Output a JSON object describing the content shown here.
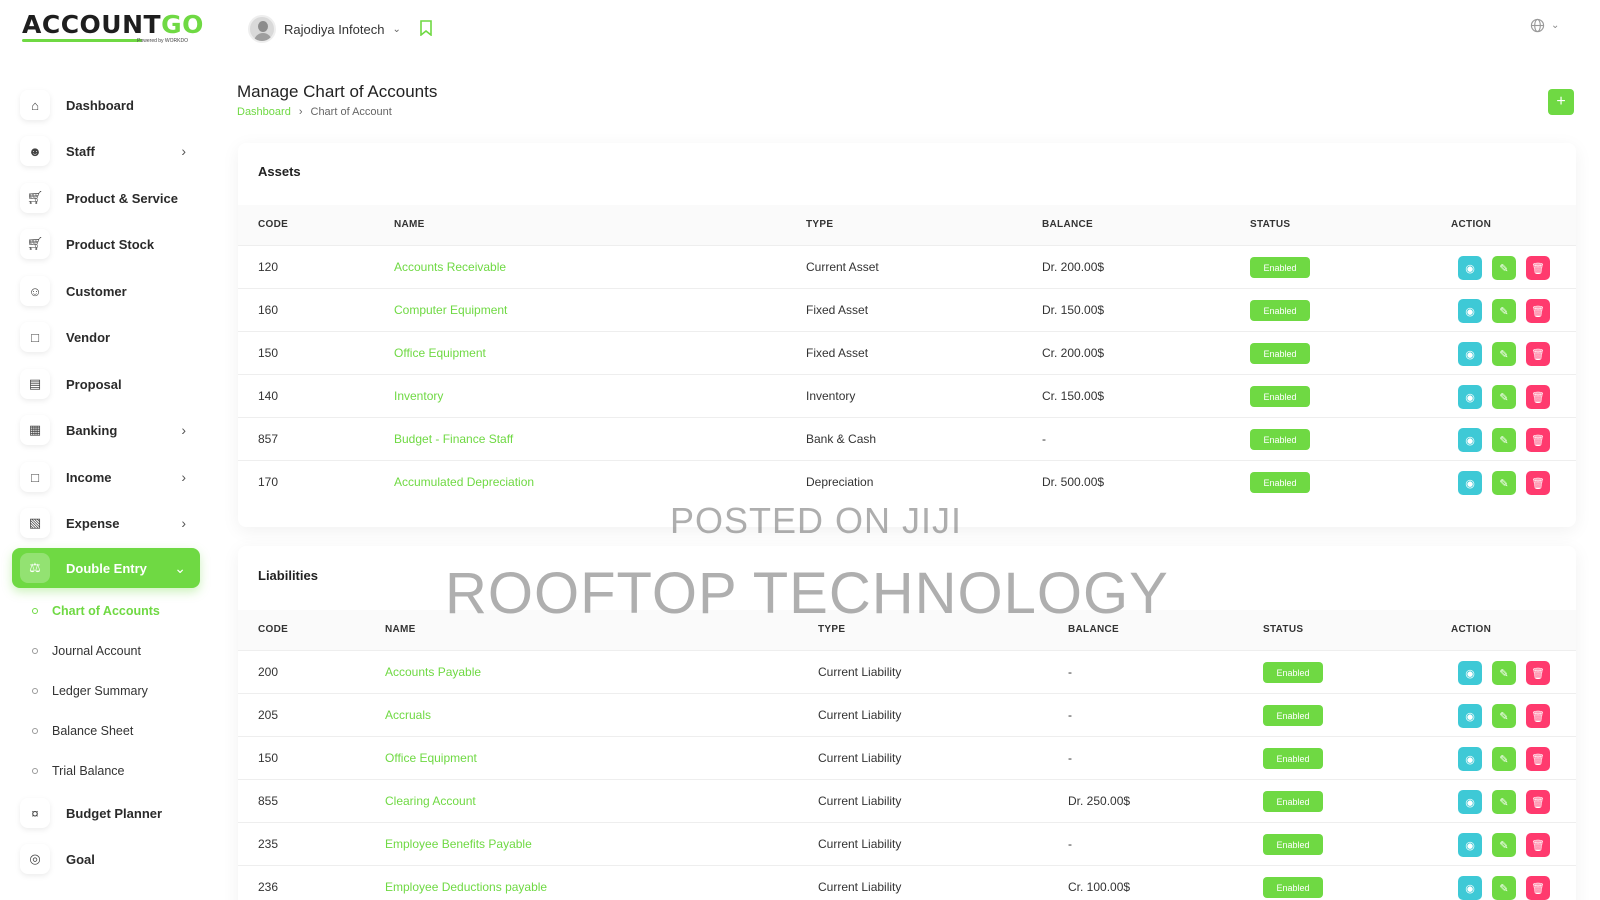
{
  "app": {
    "logo_main": "ACCOUNT",
    "logo_accent": "GO",
    "logo_sub": "Powered by WORKDO"
  },
  "header": {
    "user_name": "Rajodiya Infotech"
  },
  "sidebar": {
    "items": [
      {
        "label": "Dashboard",
        "icon": "home-icon",
        "has_children": false
      },
      {
        "label": "Staff",
        "icon": "users-icon",
        "has_children": true
      },
      {
        "label": "Product & Service",
        "icon": "cart-icon",
        "has_children": false
      },
      {
        "label": "Product Stock",
        "icon": "cart-icon",
        "has_children": false
      },
      {
        "label": "Customer",
        "icon": "user-plus-icon",
        "has_children": false
      },
      {
        "label": "Vendor",
        "icon": "note-icon",
        "has_children": false
      },
      {
        "label": "Proposal",
        "icon": "document-icon",
        "has_children": false
      },
      {
        "label": "Banking",
        "icon": "bank-icon",
        "has_children": true
      },
      {
        "label": "Income",
        "icon": "file-icon",
        "has_children": true
      },
      {
        "label": "Expense",
        "icon": "clipboard-icon",
        "has_children": true
      },
      {
        "label": "Double Entry",
        "icon": "scale-icon",
        "has_children": true,
        "active": true
      },
      {
        "label": "Budget Planner",
        "icon": "coins-icon",
        "has_children": false
      },
      {
        "label": "Goal",
        "icon": "target-icon",
        "has_children": false
      }
    ],
    "sub_items": [
      {
        "label": "Chart of Accounts",
        "active": true
      },
      {
        "label": "Journal Account"
      },
      {
        "label": "Ledger Summary"
      },
      {
        "label": "Balance Sheet"
      },
      {
        "label": "Trial Balance"
      }
    ]
  },
  "page": {
    "title": "Manage Chart of Accounts",
    "breadcrumb": [
      "Dashboard",
      "Chart of Account"
    ],
    "add_label": "+"
  },
  "assets": {
    "title": "Assets",
    "headers": [
      "CODE",
      "NAME",
      "TYPE",
      "BALANCE",
      "STATUS",
      "ACTION"
    ],
    "rows": [
      {
        "code": "120",
        "name": "Accounts Receivable",
        "type": "Current Asset",
        "balance": "Dr. 200.00$",
        "status": "Enabled"
      },
      {
        "code": "160",
        "name": "Computer Equipment",
        "type": "Fixed Asset",
        "balance": "Dr. 150.00$",
        "status": "Enabled"
      },
      {
        "code": "150",
        "name": "Office Equipment",
        "type": "Fixed Asset",
        "balance": "Cr. 200.00$",
        "status": "Enabled"
      },
      {
        "code": "140",
        "name": "Inventory",
        "type": "Inventory",
        "balance": "Cr. 150.00$",
        "status": "Enabled"
      },
      {
        "code": "857",
        "name": "Budget - Finance Staff",
        "type": "Bank & Cash",
        "balance": "-",
        "status": "Enabled"
      },
      {
        "code": "170",
        "name": "Accumulated Depreciation",
        "type": "Depreciation",
        "balance": "Dr. 500.00$",
        "status": "Enabled"
      }
    ]
  },
  "liabilities": {
    "title": "Liabilities",
    "headers": [
      "CODE",
      "NAME",
      "TYPE",
      "BALANCE",
      "STATUS",
      "ACTION"
    ],
    "rows": [
      {
        "code": "200",
        "name": "Accounts Payable",
        "type": "Current Liability",
        "balance": "-",
        "status": "Enabled"
      },
      {
        "code": "205",
        "name": "Accruals",
        "type": "Current Liability",
        "balance": "-",
        "status": "Enabled"
      },
      {
        "code": "150",
        "name": "Office Equipment",
        "type": "Current Liability",
        "balance": "-",
        "status": "Enabled"
      },
      {
        "code": "855",
        "name": "Clearing Account",
        "type": "Current Liability",
        "balance": "Dr. 250.00$",
        "status": "Enabled"
      },
      {
        "code": "235",
        "name": "Employee Benefits Payable",
        "type": "Current Liability",
        "balance": "-",
        "status": "Enabled"
      },
      {
        "code": "236",
        "name": "Employee Deductions payable",
        "type": "Current Liability",
        "balance": "Cr. 100.00$",
        "status": "Enabled"
      }
    ]
  },
  "watermarks": [
    "POSTED ON JIJI",
    "ROOFTOP TECHNOLOGY"
  ],
  "colors": {
    "accent": "#6fd943",
    "view": "#3ec9d6",
    "delete": "#ff3a6e"
  }
}
